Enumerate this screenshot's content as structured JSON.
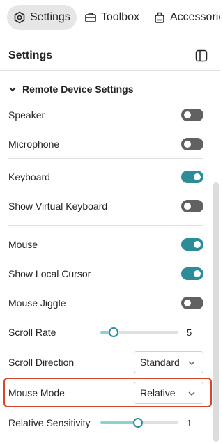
{
  "tabs": [
    {
      "label": "Settings",
      "icon": "gear-icon",
      "active": true
    },
    {
      "label": "Toolbox",
      "icon": "toolbox-icon",
      "active": false
    },
    {
      "label": "Accessories",
      "icon": "accessories-icon",
      "active": false
    }
  ],
  "panel": {
    "title": "Settings",
    "toggle_icon": "panel-toggle-icon"
  },
  "section": {
    "title": "Remote Device Settings",
    "expanded": true
  },
  "settings": {
    "speaker": {
      "label": "Speaker",
      "on": false
    },
    "microphone": {
      "label": "Microphone",
      "on": false
    },
    "keyboard": {
      "label": "Keyboard",
      "on": true
    },
    "show_virtual_keyboard": {
      "label": "Show Virtual Keyboard",
      "on": false
    },
    "mouse": {
      "label": "Mouse",
      "on": true
    },
    "show_local_cursor": {
      "label": "Show Local Cursor",
      "on": true
    },
    "mouse_jiggle": {
      "label": "Mouse Jiggle",
      "on": false
    },
    "scroll_rate": {
      "label": "Scroll Rate",
      "value": "5",
      "fraction": 0.17
    },
    "scroll_direction": {
      "label": "Scroll Direction",
      "value": "Standard"
    },
    "mouse_mode": {
      "label": "Mouse Mode",
      "value": "Relative"
    },
    "relative_sensitivity": {
      "label": "Relative Sensitivity",
      "value": "1",
      "fraction": 0.48
    }
  },
  "colors": {
    "accent": "#2e8b9a",
    "highlight": "#d9442f"
  }
}
